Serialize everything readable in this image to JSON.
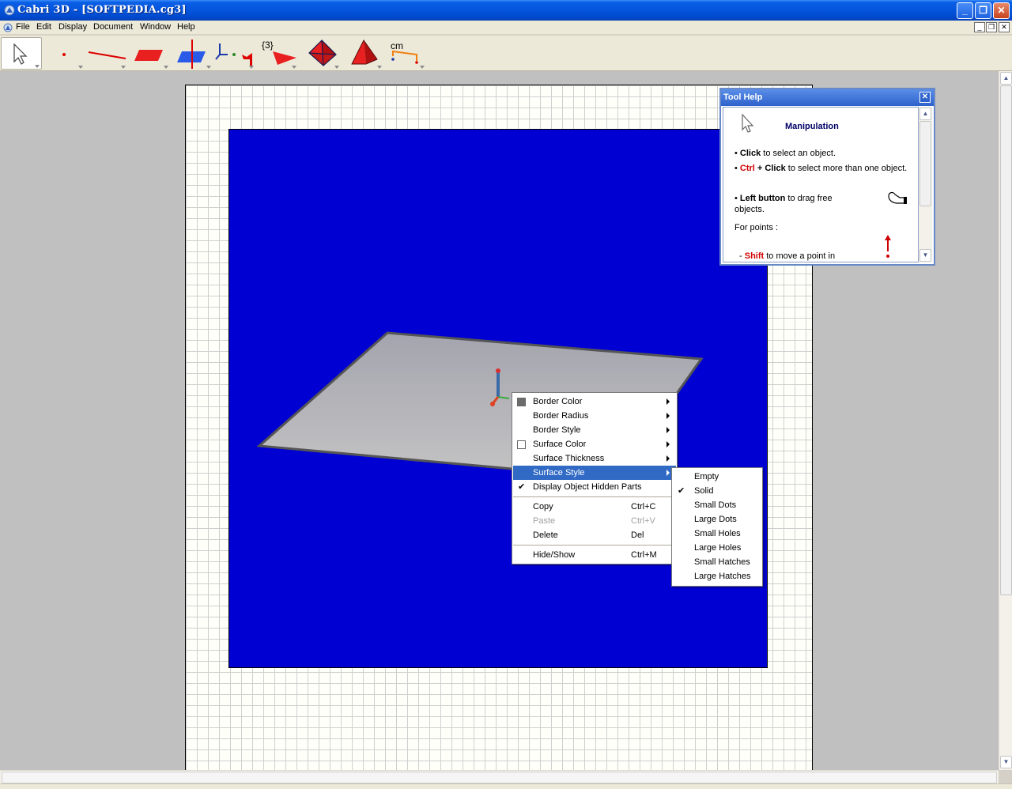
{
  "window": {
    "title": "Cabri 3D - [SOFTPEDIA.cg3]"
  },
  "menubar": {
    "items": [
      "File",
      "Edit",
      "Display",
      "Document",
      "Window",
      "Help"
    ]
  },
  "toolbar": {
    "tools": [
      {
        "name": "manipulation-tool",
        "icon": "arrow-pointer-icon"
      },
      {
        "name": "point-tool",
        "icon": "point-icon"
      },
      {
        "name": "line-tool",
        "icon": "line-icon"
      },
      {
        "name": "plane-tool",
        "icon": "plane-icon"
      },
      {
        "name": "perpendicular-tool",
        "icon": "perpendicular-icon"
      },
      {
        "name": "transformation-tool",
        "icon": "transformation-icon"
      },
      {
        "name": "regular-polygon-tool",
        "icon": "polygon-icon",
        "label": "{3}"
      },
      {
        "name": "polyhedron-tool",
        "icon": "tetrahedron-icon"
      },
      {
        "name": "pyramid-tool",
        "icon": "pyramid-icon"
      },
      {
        "name": "measurement-tool",
        "icon": "measure-icon",
        "label": "cm"
      }
    ]
  },
  "tool_help": {
    "header": "Tool Help",
    "title": "Manipulation",
    "lines": {
      "l1_bold": "Click",
      "l1_rest": " to select an object.",
      "l2_red": "Ctrl",
      "l2_bold": " + Click",
      "l2_rest": " to select more than one object.",
      "l3_bold": "Left button",
      "l3_rest": " to drag free",
      "l3b": "objects.",
      "l4": "For points :",
      "l5_red": "Shift",
      "l5_rest": " to move a point in"
    }
  },
  "context_menu": {
    "items": [
      {
        "label": "Border Color",
        "submenu": true,
        "swatch": "#6b6b6b"
      },
      {
        "label": "Border Radius",
        "submenu": true
      },
      {
        "label": "Border Style",
        "submenu": true
      },
      {
        "label": "Surface Color",
        "submenu": true,
        "swatch": "#ffffff"
      },
      {
        "label": "Surface Thickness",
        "submenu": true
      },
      {
        "label": "Surface Style",
        "submenu": true,
        "highlighted": true
      },
      {
        "label": "Display Object Hidden Parts",
        "checked": true
      },
      {
        "label": "Copy",
        "shortcut": "Ctrl+C"
      },
      {
        "label": "Paste",
        "shortcut": "Ctrl+V",
        "disabled": true
      },
      {
        "label": "Delete",
        "shortcut": "Del"
      },
      {
        "label": "Hide/Show",
        "shortcut": "Ctrl+M"
      }
    ]
  },
  "surface_style_menu": {
    "items": [
      "Empty",
      "Solid",
      "Small Dots",
      "Large Dots",
      "Small Holes",
      "Large Holes",
      "Small Hatches",
      "Large Hatches"
    ],
    "checked": "Solid"
  },
  "colors": {
    "view_background": "#0000d2",
    "highlight": "#316ac5",
    "titlebar": "#0455dc"
  }
}
